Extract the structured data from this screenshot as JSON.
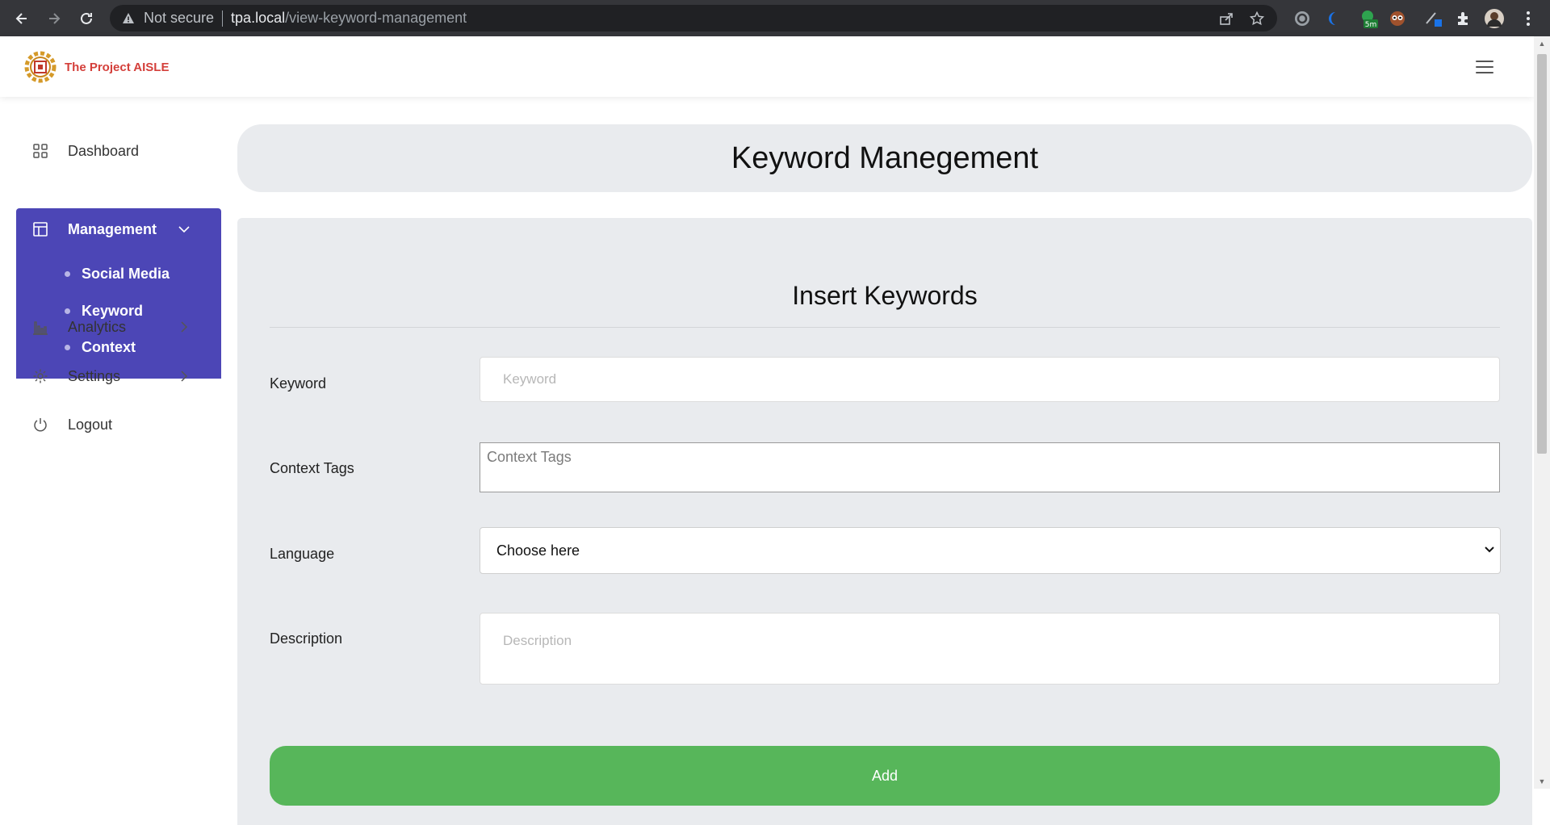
{
  "browser": {
    "security_label": "Not secure",
    "url_host": "tpa.local",
    "url_path": "/view-keyword-management",
    "extension_badge": "5m"
  },
  "header": {
    "brand": "The Project AISLE"
  },
  "sidebar": {
    "items": [
      {
        "label": "Dashboard",
        "icon": "grid-icon"
      },
      {
        "label": "Management",
        "icon": "layout-icon",
        "expanded": true
      },
      {
        "label": "Analytics",
        "icon": "bar-chart-icon"
      },
      {
        "label": "Settings",
        "icon": "gear-icon"
      },
      {
        "label": "Logout",
        "icon": "power-icon"
      }
    ],
    "management_sub": [
      {
        "label": "Social Media"
      },
      {
        "label": "Keyword"
      },
      {
        "label": "Context"
      }
    ],
    "accent_color": "#4c46b6"
  },
  "main": {
    "page_title": "Keyword Manegement",
    "form_title": "Insert Keywords",
    "fields": {
      "keyword": {
        "label": "Keyword",
        "placeholder": "Keyword"
      },
      "context_tags": {
        "label": "Context Tags",
        "placeholder": "Context Tags"
      },
      "language": {
        "label": "Language",
        "selected": "Choose here"
      },
      "description": {
        "label": "Description",
        "placeholder": "Description"
      }
    },
    "add_button": "Add",
    "add_button_color": "#57b65a"
  }
}
